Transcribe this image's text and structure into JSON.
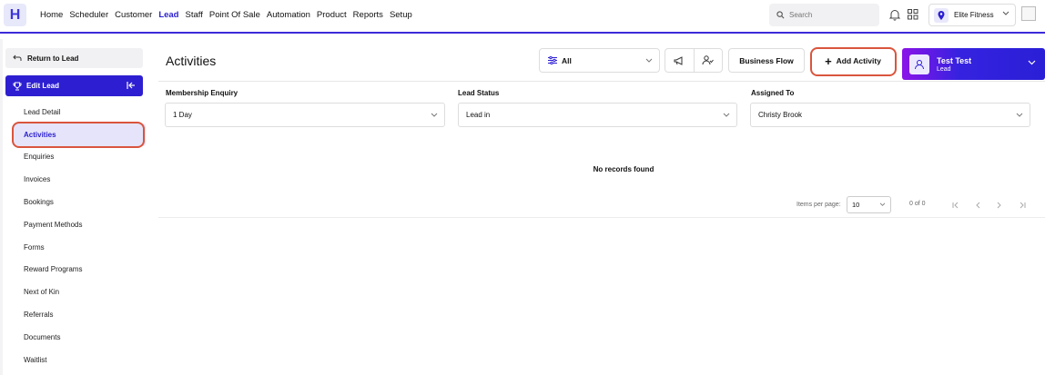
{
  "app": {
    "logo_letter": "H"
  },
  "nav": {
    "items": [
      "Home",
      "Scheduler",
      "Customer",
      "Lead",
      "Staff",
      "Point Of Sale",
      "Automation",
      "Product",
      "Reports",
      "Setup"
    ],
    "active": "Lead"
  },
  "header": {
    "search_placeholder": "Search",
    "location": "Elite Fitness"
  },
  "sidebar": {
    "return_label": "Return to Lead",
    "edit_lead_label": "Edit Lead",
    "items": [
      "Lead Detail",
      "Activities",
      "Enquiries",
      "Invoices",
      "Bookings",
      "Payment Methods",
      "Forms",
      "Reward Programs",
      "Next of Kin",
      "Referrals",
      "Documents",
      "Waitlist"
    ],
    "active": "Activities"
  },
  "main": {
    "title": "Activities",
    "filter_value": "All",
    "business_flow_label": "Business Flow",
    "add_activity_label": "Add Activity",
    "user": {
      "name": "Test Test",
      "role": "Lead"
    },
    "fields": {
      "membership_label": "Membership Enquiry",
      "membership_value": "1 Day",
      "status_label": "Lead Status",
      "status_value": "Lead in",
      "assigned_label": "Assigned To",
      "assigned_value": "Christy Brook"
    },
    "empty_message": "No records found",
    "pagination": {
      "items_per_page_label": "Items per page:",
      "items_per_page_value": "10",
      "range_text": "0 of 0"
    }
  },
  "colors": {
    "brand": "#2d1fd1",
    "highlight_ring": "#d9553d"
  }
}
